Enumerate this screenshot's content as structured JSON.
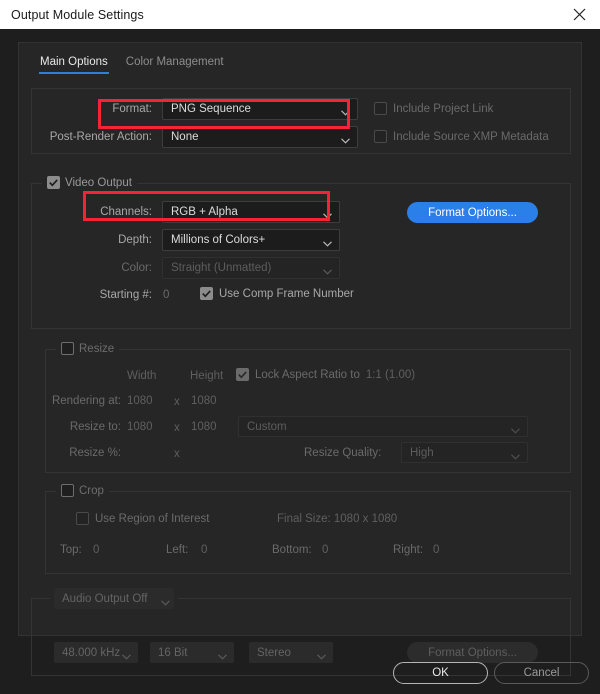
{
  "window": {
    "title": "Output Module Settings",
    "close_icon": "close-icon"
  },
  "tabs": [
    {
      "label": "Main Options",
      "active": true
    },
    {
      "label": "Color Management",
      "active": false
    }
  ],
  "format_section": {
    "format_label": "Format:",
    "format_value": "PNG Sequence",
    "post_render_label": "Post-Render Action:",
    "post_render_value": "None",
    "include_project_link": "Include Project Link",
    "include_xmp": "Include Source XMP Metadata"
  },
  "video_output": {
    "legend": "Video Output",
    "checked": true,
    "channels_label": "Channels:",
    "channels_value": "RGB + Alpha",
    "depth_label": "Depth:",
    "depth_value": "Millions of Colors+",
    "color_label": "Color:",
    "color_value": "Straight (Unmatted)",
    "starting_label": "Starting #:",
    "starting_value": "0",
    "use_comp_frame_number": "Use Comp Frame Number",
    "format_options_button": "Format Options..."
  },
  "resize": {
    "legend": "Resize",
    "checked": false,
    "width_header": "Width",
    "height_header": "Height",
    "lock_aspect_label": "Lock Aspect Ratio to",
    "lock_aspect_value": "1:1 (1.00)",
    "rendering_at_label": "Rendering at:",
    "rendering_at_width": "1080",
    "rendering_at_height": "1080",
    "resize_to_label": "Resize to:",
    "resize_to_width": "1080",
    "resize_to_height": "1080",
    "resize_preset": "Custom",
    "resize_pct_label": "Resize %:",
    "x_separator": "x",
    "resize_quality_label": "Resize Quality:",
    "resize_quality_value": "High"
  },
  "crop": {
    "legend": "Crop",
    "checked": false,
    "use_region_of_interest": "Use Region of Interest",
    "final_size": "Final Size: 1080 x 1080",
    "top_label": "Top:",
    "top_value": "0",
    "left_label": "Left:",
    "left_value": "0",
    "bottom_label": "Bottom:",
    "bottom_value": "0",
    "right_label": "Right:",
    "right_value": "0"
  },
  "audio": {
    "toggle_value": "Audio Output Off",
    "sample_rate": "48.000 kHz",
    "bit_depth": "16 Bit",
    "channels": "Stereo",
    "format_options_button": "Format Options..."
  },
  "footer": {
    "ok": "OK",
    "cancel": "Cancel"
  },
  "annotations": {
    "highlight_color": "#f42434",
    "boxes": [
      "format-row-highlight",
      "channels-row-highlight"
    ]
  },
  "colors": {
    "accent_blue": "#2a7fe8",
    "tab_underline": "#2f7fd6",
    "panel_bg": "#262626",
    "dialog_bg": "#1e1e1e",
    "titlebar_bg": "#ffffff"
  }
}
